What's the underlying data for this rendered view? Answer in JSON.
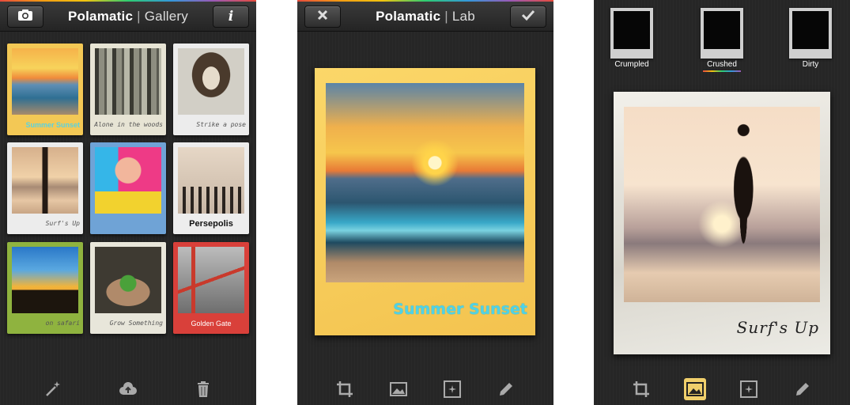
{
  "gallery": {
    "title_brand": "Polamatic",
    "title_section": "Gallery",
    "left_icon": "camera-icon",
    "right_label": "i",
    "cards": [
      {
        "caption": "Summer Sunset",
        "frame": "#f3c855",
        "style": "cyan"
      },
      {
        "caption": "Alone in the woods",
        "frame": "#e7e4d4",
        "style": "script"
      },
      {
        "caption": "Strike a pose",
        "frame": "#ececec",
        "style": "script"
      },
      {
        "caption": "Surf's Up",
        "frame": "#ececec",
        "style": "script"
      },
      {
        "caption": "",
        "frame": "#6fa3d6",
        "style": "script"
      },
      {
        "caption": "Persepolis",
        "frame": "#ededed",
        "style": "bold"
      },
      {
        "caption": "on safari",
        "frame": "#8fb33f",
        "style": "script"
      },
      {
        "caption": "Grow Something",
        "frame": "#e8e6da",
        "style": "script"
      },
      {
        "caption": "Golden Gate",
        "frame": "#d9403a",
        "style": "white"
      }
    ],
    "bottom_icons": [
      "magic-wand-icon",
      "cloud-upload-icon",
      "trash-icon"
    ]
  },
  "lab": {
    "title_brand": "Polamatic",
    "title_section": "Lab",
    "left_icon": "close-icon",
    "right_icon": "check-icon",
    "polaroid_caption": "Summer Sunset",
    "frame_color": "#f6c85a",
    "bottom_icons": [
      "crop-icon",
      "image-icon",
      "sparkle-icon",
      "pencil-icon"
    ]
  },
  "filters": {
    "items": [
      {
        "label": "Crumpled"
      },
      {
        "label": "Crushed",
        "selected": true
      },
      {
        "label": "Dirty"
      }
    ],
    "polaroid_caption": "Surf's Up",
    "bottom_icons": [
      "crop-icon",
      "image-icon",
      "sparkle-icon",
      "pencil-icon"
    ],
    "active_icon": "image-icon"
  },
  "colors": {
    "toolbar": "#2e2e2e",
    "background": "#262626",
    "active_tool": "#f0cf6b",
    "caption_cyan": "#4fd2e6"
  }
}
